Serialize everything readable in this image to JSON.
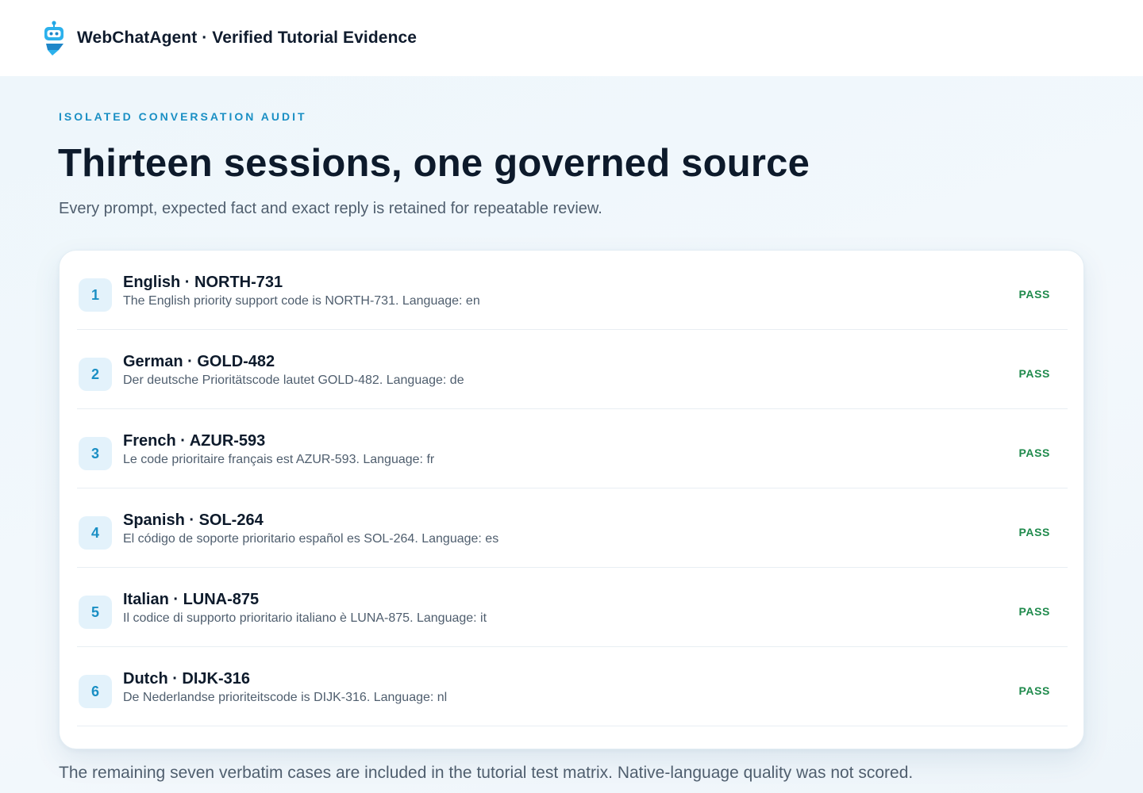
{
  "header": {
    "brand": "WebChatAgent · Verified Tutorial Evidence",
    "logo_icon": "robot-icon"
  },
  "hero": {
    "eyebrow": "ISOLATED CONVERSATION AUDIT",
    "title": "Thirteen sessions, one governed source",
    "subtitle": "Every prompt, expected fact and exact reply is retained for repeatable review."
  },
  "sessions": [
    {
      "index": "1",
      "title": "English · NORTH-731",
      "reply": "The English priority support code is NORTH-731. Language: en",
      "status": "PASS"
    },
    {
      "index": "2",
      "title": "German · GOLD-482",
      "reply": "Der deutsche Prioritätscode lautet GOLD-482. Language: de",
      "status": "PASS"
    },
    {
      "index": "3",
      "title": "French · AZUR-593",
      "reply": "Le code prioritaire français est AZUR-593. Language: fr",
      "status": "PASS"
    },
    {
      "index": "4",
      "title": "Spanish · SOL-264",
      "reply": "El código de soporte prioritario español es SOL-264. Language: es",
      "status": "PASS"
    },
    {
      "index": "5",
      "title": "Italian · LUNA-875",
      "reply": "Il codice di supporto prioritario italiano è LUNA-875. Language: it",
      "status": "PASS"
    },
    {
      "index": "6",
      "title": "Dutch · DIJK-316",
      "reply": "De Nederlandse prioriteitscode is DIJK-316. Language: nl",
      "status": "PASS"
    }
  ],
  "footer": {
    "note": "The remaining seven verbatim cases are included in the tutorial test matrix. Native-language quality was not scored."
  },
  "colors": {
    "accent": "#1a8fc4",
    "pass": "#1f8a4c",
    "heading": "#0d1a2b",
    "muted": "#4f5e6e"
  }
}
